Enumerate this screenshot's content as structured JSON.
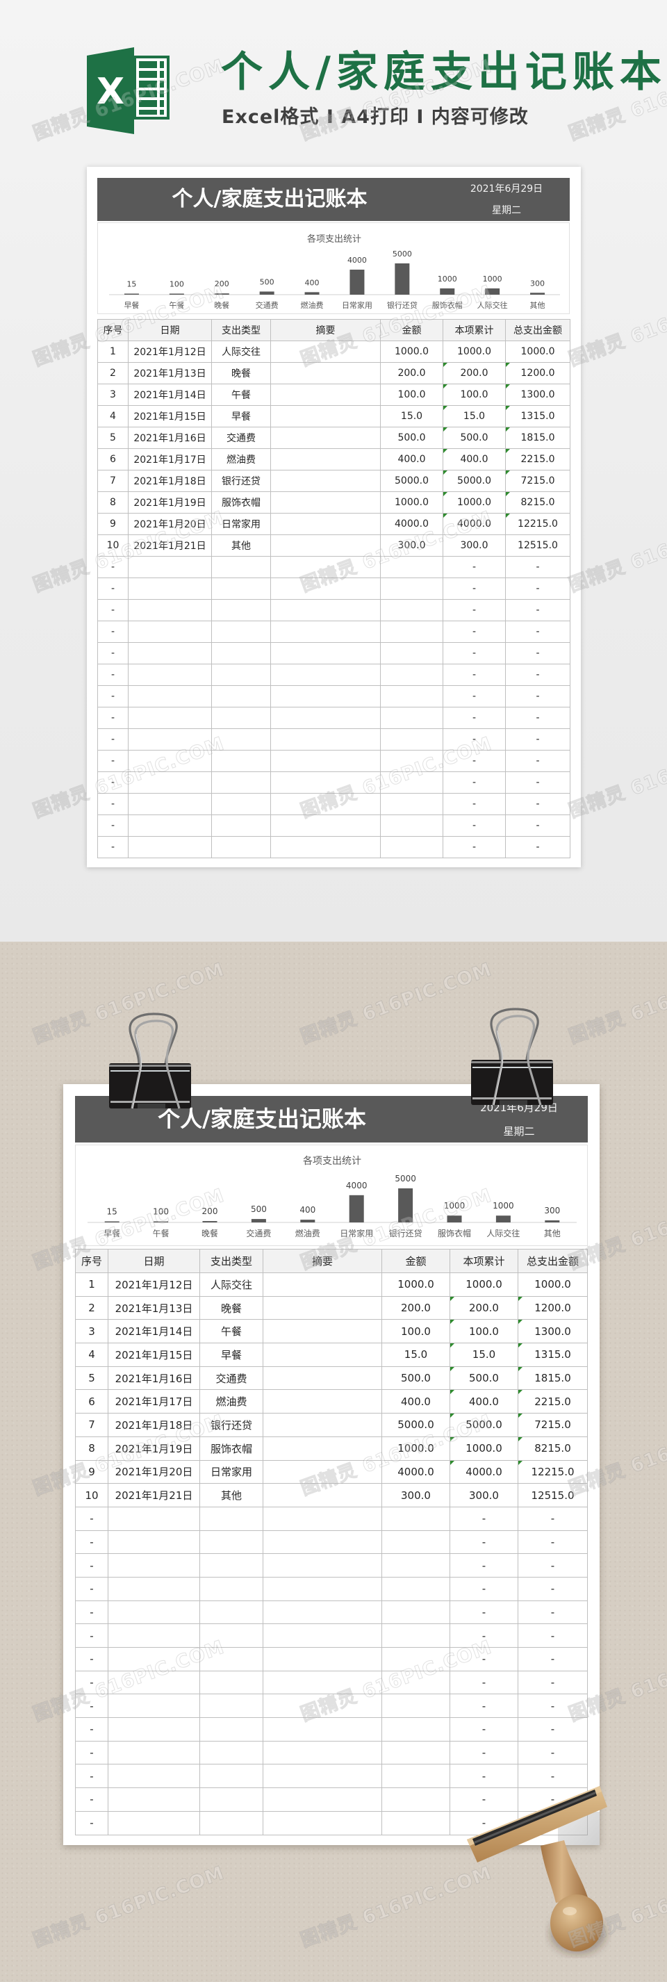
{
  "header": {
    "title": "个人/家庭支出记账本",
    "subtitle": "Excel格式 I A4打印 I 内容可修改",
    "logo_letter": "X"
  },
  "watermark": "图精灵 616PIC.COM",
  "colors": {
    "brand": "#1e7145",
    "title_bar": "#595959",
    "chart_bar": "#595959",
    "header_row": "#f2f2f2",
    "grid": "#bfbfbf",
    "formula_flag": "#2e8b2e"
  },
  "ledger": {
    "title": "个人/家庭支出记账本",
    "date": "2021年6月29日",
    "weekday": "星期二",
    "columns": [
      "序号",
      "日期",
      "支出类型",
      "摘要",
      "金额",
      "本项累计",
      "总支出金额"
    ],
    "rows": [
      [
        "1",
        "2021年1月12日",
        "人际交往",
        "",
        "1000.0",
        "1000.0",
        "1000.0"
      ],
      [
        "2",
        "2021年1月13日",
        "晚餐",
        "",
        "200.0",
        "200.0",
        "1200.0"
      ],
      [
        "3",
        "2021年1月14日",
        "午餐",
        "",
        "100.0",
        "100.0",
        "1300.0"
      ],
      [
        "4",
        "2021年1月15日",
        "早餐",
        "",
        "15.0",
        "15.0",
        "1315.0"
      ],
      [
        "5",
        "2021年1月16日",
        "交通费",
        "",
        "500.0",
        "500.0",
        "1815.0"
      ],
      [
        "6",
        "2021年1月17日",
        "燃油费",
        "",
        "400.0",
        "400.0",
        "2215.0"
      ],
      [
        "7",
        "2021年1月18日",
        "银行还贷",
        "",
        "5000.0",
        "5000.0",
        "7215.0"
      ],
      [
        "8",
        "2021年1月19日",
        "服饰衣帽",
        "",
        "1000.0",
        "1000.0",
        "8215.0"
      ],
      [
        "9",
        "2021年1月20日",
        "日常家用",
        "",
        "4000.0",
        "4000.0",
        "12215.0"
      ],
      [
        "10",
        "2021年1月21日",
        "其他",
        "",
        "300.0",
        "300.0",
        "12515.0"
      ],
      [
        "-",
        "",
        "",
        "",
        "",
        "-",
        "-"
      ],
      [
        "-",
        "",
        "",
        "",
        "",
        "-",
        "-"
      ],
      [
        "-",
        "",
        "",
        "",
        "",
        "-",
        "-"
      ],
      [
        "-",
        "",
        "",
        "",
        "",
        "-",
        "-"
      ],
      [
        "-",
        "",
        "",
        "",
        "",
        "-",
        "-"
      ],
      [
        "-",
        "",
        "",
        "",
        "",
        "-",
        "-"
      ],
      [
        "-",
        "",
        "",
        "",
        "",
        "-",
        "-"
      ],
      [
        "-",
        "",
        "",
        "",
        "",
        "-",
        "-"
      ],
      [
        "-",
        "",
        "",
        "",
        "",
        "-",
        "-"
      ],
      [
        "-",
        "",
        "",
        "",
        "",
        "-",
        "-"
      ],
      [
        "-",
        "",
        "",
        "",
        "",
        "-",
        "-"
      ],
      [
        "-",
        "",
        "",
        "",
        "",
        "-",
        "-"
      ],
      [
        "-",
        "",
        "",
        "",
        "",
        "-",
        "-"
      ],
      [
        "-",
        "",
        "",
        "",
        "",
        "-",
        "-"
      ]
    ],
    "formula_flag_rows": [
      2,
      3,
      4,
      5,
      6,
      7,
      8,
      9
    ]
  },
  "chart_data": [
    {
      "type": "bar",
      "title": "各项支出统计",
      "categories": [
        "早餐",
        "午餐",
        "晚餐",
        "交通费",
        "燃油费",
        "日常家用",
        "银行还贷",
        "服饰衣帽",
        "人际交往",
        "其他"
      ],
      "values": [
        15,
        100,
        200,
        500,
        400,
        4000,
        5000,
        1000,
        1000,
        300
      ],
      "xlabel": "",
      "ylabel": "",
      "data_labels": true,
      "grid": false,
      "legend": "none"
    },
    {
      "type": "bar",
      "title": "各项支出统计",
      "categories": [
        "早餐",
        "午餐",
        "晚餐",
        "交通费",
        "燃油费",
        "日常家用",
        "银行还贷",
        "服饰衣帽",
        "人际交往",
        "其他"
      ],
      "values": [
        15,
        100,
        200,
        500,
        400,
        4000,
        5000,
        1000,
        1000,
        300
      ],
      "xlabel": "",
      "ylabel": "",
      "data_labels": true,
      "grid": false,
      "legend": "none"
    }
  ]
}
